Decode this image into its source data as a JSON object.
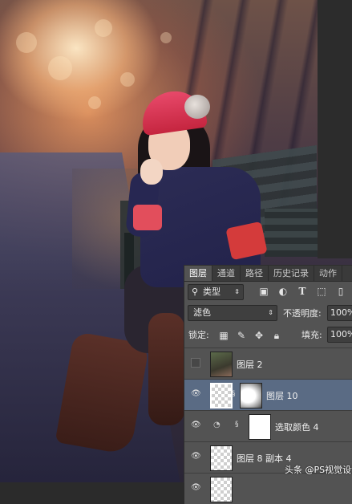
{
  "photo": {
    "description_free": true
  },
  "layers_panel": {
    "tabs": [
      {
        "label": "图层",
        "active": true
      },
      {
        "label": "通道",
        "active": false
      },
      {
        "label": "路径",
        "active": false
      },
      {
        "label": "历史记录",
        "active": false
      },
      {
        "label": "动作",
        "active": false
      }
    ],
    "filter_kind": "类型",
    "blend_mode": "滤色",
    "opacity_label": "不透明度:",
    "opacity_value": "100%",
    "lock_label": "锁定:",
    "fill_label": "填充:",
    "fill_value": "100%",
    "layers": [
      {
        "name": "图层 2",
        "visible": false,
        "selected": false
      },
      {
        "name": "图层 10",
        "visible": true,
        "selected": true
      },
      {
        "name": "选取颜色 4",
        "visible": true,
        "selected": false
      },
      {
        "name": "图层 8 副本 4",
        "visible": true,
        "selected": false
      }
    ]
  },
  "watermark": "头条 @PS视觉设计"
}
